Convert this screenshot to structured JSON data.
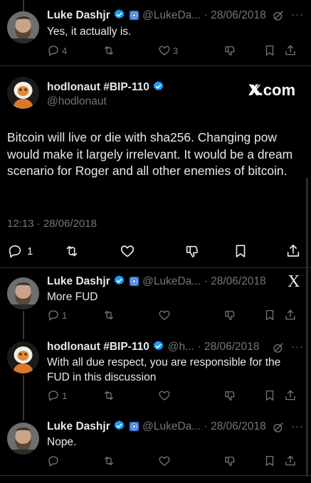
{
  "brand": {
    "x_logo_text": "X.com",
    "x_logo_small": "X"
  },
  "tweet1": {
    "name": "Luke Dashjr",
    "handle": "@LukeDa...",
    "date": "· 28/06/2018",
    "text": "Yes, it actually is.",
    "replies": "4",
    "likes": "3"
  },
  "main": {
    "name": "hodlonaut #BIP-110",
    "handle": "@hodlonaut",
    "text": "Bitcoin will live or die with sha256. Changing pow would make it largely irrelevant. It would be a dream scenario for Roger and all other enemies of bitcoin.",
    "timestamp": "12:13 · 28/06/2018",
    "replies": "1"
  },
  "reply1": {
    "name": "Luke Dashjr",
    "handle": "@LukeDa...",
    "date": "· 28/06/2018",
    "text": "More FUD",
    "replies": "1"
  },
  "reply2": {
    "name": "hodlonaut #BIP-110",
    "handle": "@h...",
    "date": "· 28/06/2018",
    "text": "With all due respect, you are responsible for the FUD in this discussion",
    "replies": "1"
  },
  "reply3": {
    "name": "Luke Dashjr",
    "handle": "@LukeDa...",
    "date": "· 28/06/2018",
    "text": "Nope."
  },
  "more_label": "···",
  "colors": {
    "background": "#000000",
    "text": "#e7e9ea",
    "muted": "#71767b",
    "verified": "#1d9bf0"
  }
}
